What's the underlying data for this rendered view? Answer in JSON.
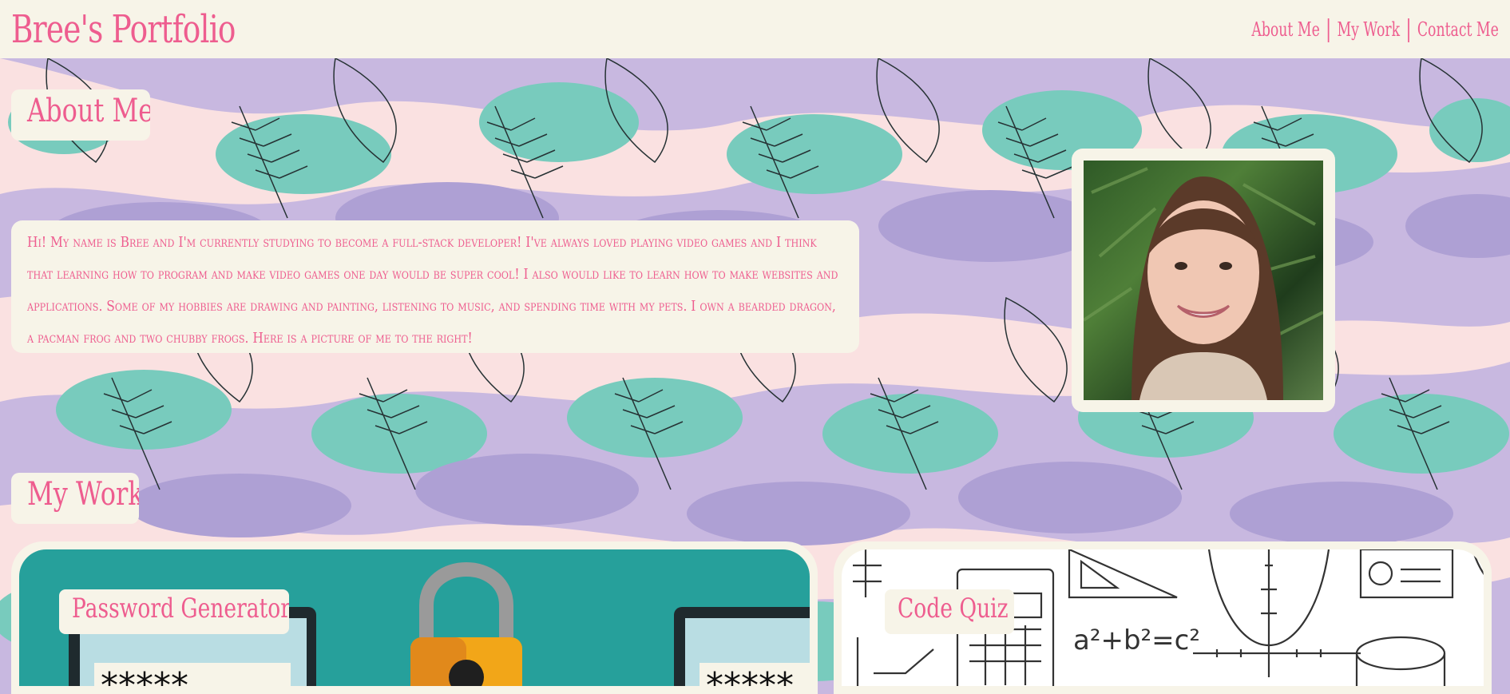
{
  "header": {
    "brand": "Bree's Portfolio",
    "nav": [
      {
        "label": "About Me"
      },
      {
        "label": "My Work"
      },
      {
        "label": "Contact Me"
      }
    ],
    "separator": "|"
  },
  "about": {
    "title": "About Me",
    "text": "Hi! My name is Bree and I'm currently studying to become a full-stack developer! I've always loved playing video games and I think that learning how to program and make video games one day would be super cool! I also would like to learn how to make websites and applications. Some of my hobbies are drawing and painting, listening to music, and spending time with my pets. I own a bearded dragon, a pacman frog and two chubby frogs. Here is a picture of me to the right!"
  },
  "work": {
    "title": "My Work",
    "projects": [
      {
        "label": "Password Generator",
        "password_text": "*****"
      },
      {
        "label": "Code Quiz",
        "formula": "a²+b²=c²"
      }
    ]
  },
  "colors": {
    "accent": "#ee5d8f",
    "cream": "#f7f4e8",
    "teal": "#26a09b",
    "lavender": "#c8b8e0"
  }
}
